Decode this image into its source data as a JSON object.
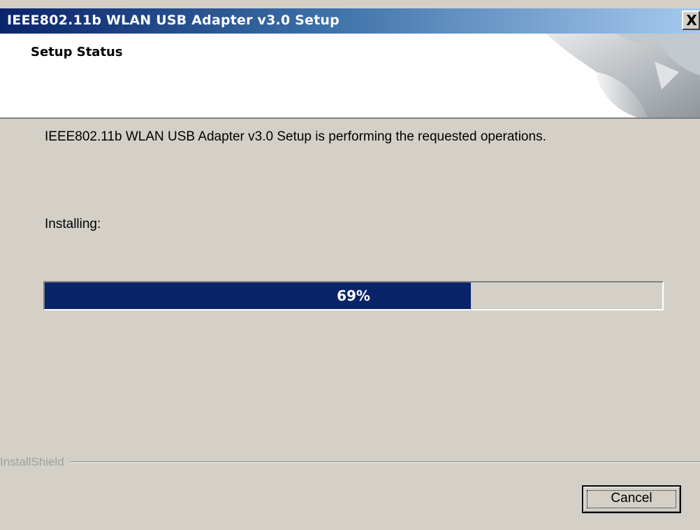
{
  "window": {
    "title": "IEEE802.11b WLAN USB Adapter v3.0 Setup",
    "close_symbol": "X"
  },
  "header": {
    "title": "Setup Status",
    "graphic_icon": "installshield-page-curl-icon"
  },
  "body": {
    "message": "IEEE802.11b WLAN USB Adapter v3.0 Setup is performing the requested operations.",
    "status_label": "Installing:"
  },
  "progress": {
    "percent": 69,
    "label": "69%"
  },
  "footer": {
    "brand": "InstallShield",
    "cancel_label": "Cancel"
  },
  "colors": {
    "titlebar_start": "#0a246a",
    "titlebar_end": "#a6caf0",
    "progress_fill": "#0a246a",
    "dialog_bg": "#d4d0c8"
  }
}
